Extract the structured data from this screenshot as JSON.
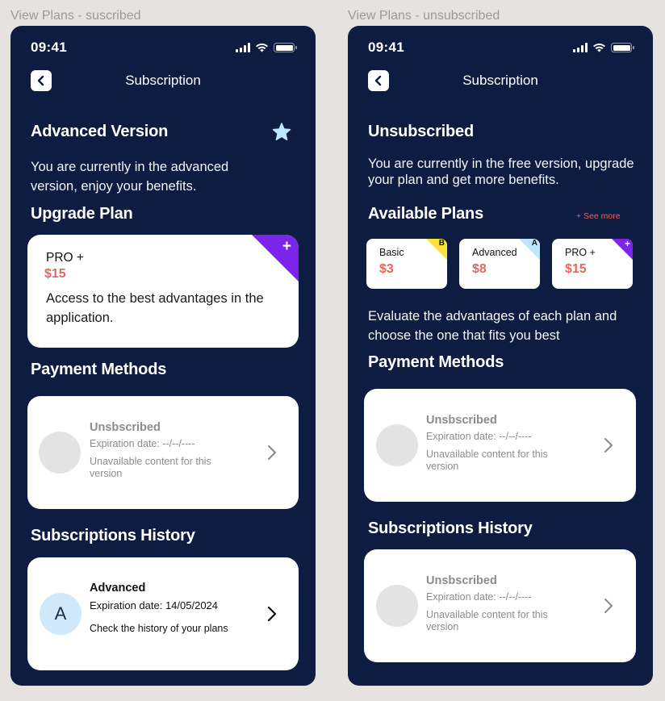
{
  "frames": [
    {
      "label": "View Plans - suscribed",
      "status_time": "09:41",
      "nav_title": "Subscription",
      "section_title": "Advanced Version",
      "description": "You are currently in the advanced version, enjoy your benefits.",
      "upgrade_title": "Upgrade Plan",
      "upgrade_card": {
        "name": "PRO +",
        "price": "$15",
        "badge": "+",
        "text": "Access to the best advantages in the application."
      },
      "payment_title": "Payment Methods",
      "payment_card": {
        "title": "Unsbscribed",
        "expiration": "Expiration date:  --/--/----",
        "note": "Unavailable content for this version"
      },
      "history_title": "Subscriptions History",
      "history_card": {
        "avatar": "A",
        "title": "Advanced",
        "expiration": "Expiration date:  14/05/2024",
        "note": "Check the history of your plans"
      }
    },
    {
      "label": "View Plans - unsubscribed",
      "status_time": "09:41",
      "nav_title": "Subscription",
      "section_title": "Unsubscribed",
      "description": "You are currently in the free version, upgrade your plan and get more benefits.",
      "plans_title": "Available Plans",
      "see_more": "+ See more",
      "plans": [
        {
          "name": "Basic",
          "price": "$3",
          "letter": "B",
          "color": "#f7e53b"
        },
        {
          "name": "Advanced",
          "price": "$8",
          "letter": "A",
          "color": "#bfe6ff"
        },
        {
          "name": "PRO +",
          "price": "$15",
          "letter": "+",
          "color": "#7b24ea"
        }
      ],
      "evaluate": "Evaluate the advantages of each plan and choose the one that fits you best",
      "payment_title": "Payment Methods",
      "payment_card": {
        "title": "Unsbscribed",
        "expiration": "Expiration date:  --/--/----",
        "note": "Unavailable content for this version"
      },
      "history_title": "Subscriptions History",
      "history_card": {
        "title": "Unsbscribed",
        "expiration": "Expiration date:  --/--/----",
        "note": "Unavailable content for this version"
      }
    }
  ],
  "colors": {
    "phone_bg": "#0e1c41",
    "price": "#e8665f",
    "pro_badge": "#7b24ea",
    "star": "#bfe6ff",
    "avatar_a": "#cfe9fb"
  }
}
